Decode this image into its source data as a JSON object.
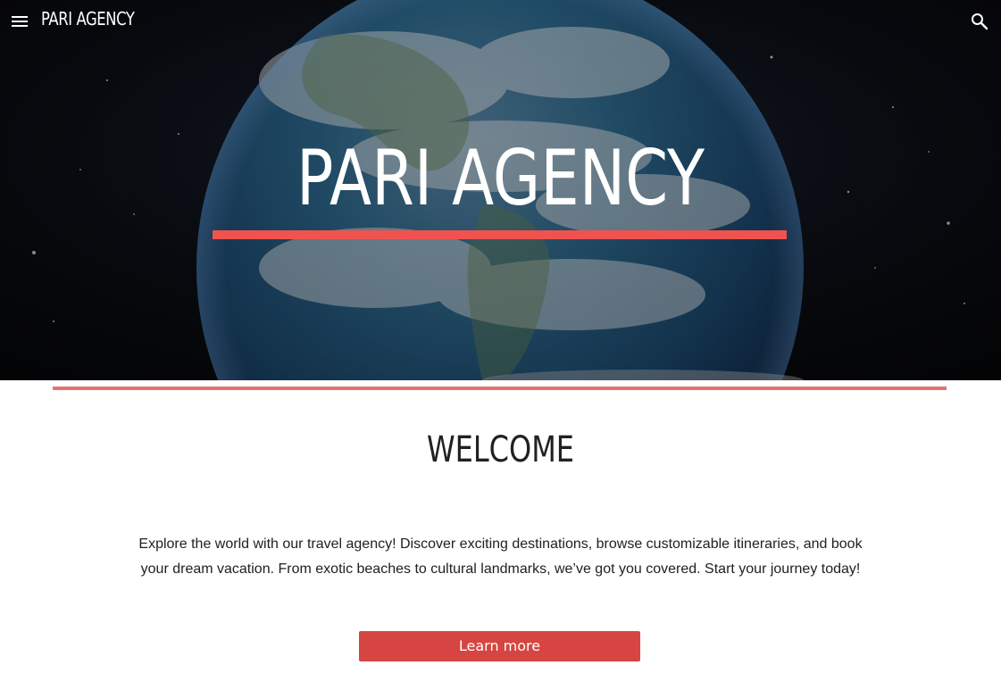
{
  "header": {
    "site_title": "PARI AGENCY",
    "menu_icon": "menu-icon",
    "search_icon": "search-icon"
  },
  "hero": {
    "title": "PARI AGENCY",
    "accent_color": "#ef5350"
  },
  "main": {
    "heading": "WELCOME",
    "intro": "Explore the world with our travel agency! Discover exciting destinations, browse customizable itineraries, and book your dream vacation. From exotic beaches to cultural landmarks, we’ve got you covered. Start your journey today!",
    "cta_label": "Learn more",
    "cta_color": "#d64541",
    "divider_color": "#e57373"
  }
}
